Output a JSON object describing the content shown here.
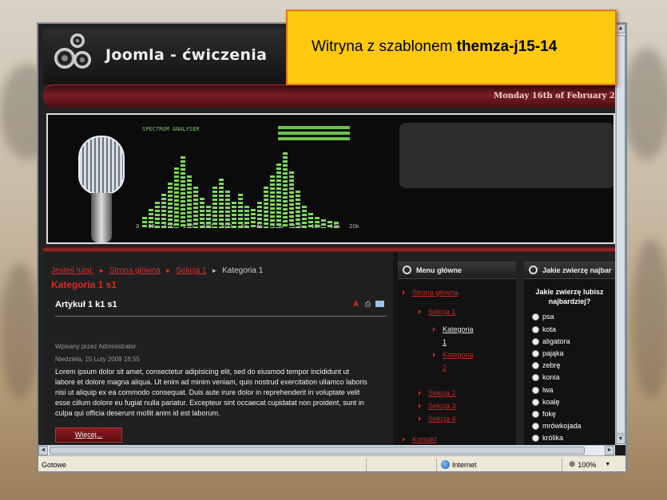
{
  "site": {
    "title": "Joomla - ćwiczenia",
    "date": "Monday 16th of February 2"
  },
  "banner": {
    "eq_label": "SPECTRUM ANALYSER",
    "eq_bars": [
      0.15,
      0.25,
      0.35,
      0.45,
      0.6,
      0.8,
      0.95,
      0.7,
      0.55,
      0.4,
      0.3,
      0.55,
      0.65,
      0.5,
      0.35,
      0.45,
      0.3,
      0.25,
      0.35,
      0.55,
      0.7,
      0.85,
      1.0,
      0.75,
      0.5,
      0.3,
      0.2,
      0.15,
      0.12,
      0.1,
      0.08
    ],
    "eq_ticks": [
      "0",
      "30",
      "100",
      "250",
      "480",
      "600",
      "8k",
      "4k",
      "7.5k",
      "12k",
      "15k",
      "18k",
      "20k"
    ]
  },
  "breadcrumb": {
    "prefix": "Jesteś tutaj:",
    "items": [
      "Strona główna",
      "Sekcja 1",
      "Kategoria 1"
    ]
  },
  "category_title": "Kategoria 1 s1",
  "article": {
    "title": "Artykuł 1 k1 s1",
    "author": "Wpisany przez Administrator",
    "date": "Niedziela, 15 Luty 2009 18:55",
    "lines": [
      "Lorem ipsum dolor sit amet, consectetur adipisicing elit, sed do eiusmod tempor incididunt ut",
      "labore et dolore magna aliqua. Ut enim ad minim veniam, quis nostrud exercitation ullamco laboris",
      "nisi ut aliquip ex ea commodo consequat. Duis aute irure dolor in reprehenderit in voluptate velit",
      "esse cillum dolore eu fugiat nulla pariatur. Excepteur sint occaecat cupidatat non proident, sunt in",
      "culpa qui officia deserunt mollit anim id est laborum."
    ],
    "more_label": "Więcej..."
  },
  "menu": {
    "title": "Menu główne",
    "items": [
      {
        "label": "Strona główna",
        "active": false
      },
      {
        "label": "Sekcja 1",
        "active": false
      },
      {
        "label": "Kategoria",
        "active": true
      },
      {
        "label": "1",
        "active": true
      },
      {
        "label": "Kategoria",
        "active": false
      },
      {
        "label": "2",
        "active": false
      },
      {
        "label": "Sekcja 2",
        "active": false
      },
      {
        "label": "Sekcja 3",
        "active": false
      },
      {
        "label": "Sekcja 4",
        "active": false
      },
      {
        "label": "Kontakt",
        "active": false
      }
    ]
  },
  "poll": {
    "title": "Jakie zwierzę najbar",
    "question_lines": [
      "Jakie zwierzę lubisz",
      "najbardziej?"
    ],
    "options": [
      "psa",
      "kota",
      "aligatora",
      "pająka",
      "zebrę",
      "konia",
      "lwa",
      "koalę",
      "fokę",
      "mrówkojada",
      "królika"
    ]
  },
  "status_bar": {
    "left": "Gotowe",
    "zone": "Internet",
    "zoom": "100%"
  },
  "callout": {
    "prefix": "Witryna z szablonem ",
    "bold": "themza-j15-14"
  }
}
